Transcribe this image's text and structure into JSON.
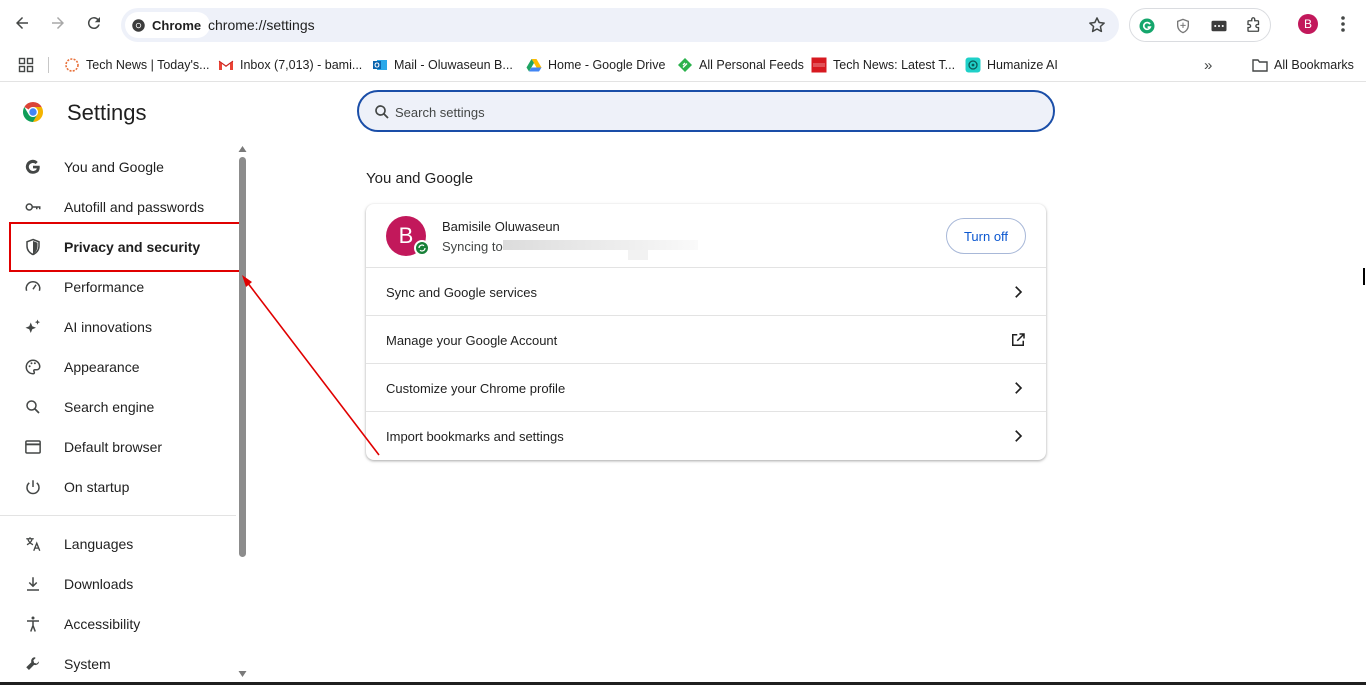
{
  "toolbar": {
    "chip_label": "Chrome",
    "url": "chrome://settings",
    "profile_initial": "B"
  },
  "bookmarks": [
    {
      "label": "Tech News | Today's..."
    },
    {
      "label": "Inbox (7,013) - bami..."
    },
    {
      "label": "Mail - Oluwaseun B..."
    },
    {
      "label": "Home - Google Drive"
    },
    {
      "label": "All Personal Feeds"
    },
    {
      "label": "Tech News: Latest T..."
    },
    {
      "label": "Humanize AI"
    }
  ],
  "bookmarks_overflow": "»",
  "all_bookmarks": "All Bookmarks",
  "sidebar": {
    "title": "Settings",
    "items": [
      {
        "label": "You and Google"
      },
      {
        "label": "Autofill and passwords"
      },
      {
        "label": "Privacy and security"
      },
      {
        "label": "Performance"
      },
      {
        "label": "AI innovations"
      },
      {
        "label": "Appearance"
      },
      {
        "label": "Search engine"
      },
      {
        "label": "Default browser"
      },
      {
        "label": "On startup"
      },
      {
        "label": "Languages"
      },
      {
        "label": "Downloads"
      },
      {
        "label": "Accessibility"
      },
      {
        "label": "System"
      }
    ]
  },
  "search": {
    "placeholder": "Search settings"
  },
  "main": {
    "section_title": "You and Google",
    "profile": {
      "initial": "B",
      "name": "Bamisile Oluwaseun",
      "sync_text": "Syncing to",
      "turn_off": "Turn off"
    },
    "rows": [
      {
        "label": "Sync and Google services"
      },
      {
        "label": "Manage your Google Account"
      },
      {
        "label": "Customize your Chrome profile"
      },
      {
        "label": "Import bookmarks and settings"
      }
    ]
  },
  "colors": {
    "accent": "#0b57d0",
    "highlight": "#e00000",
    "avatar": "#c2185b"
  }
}
